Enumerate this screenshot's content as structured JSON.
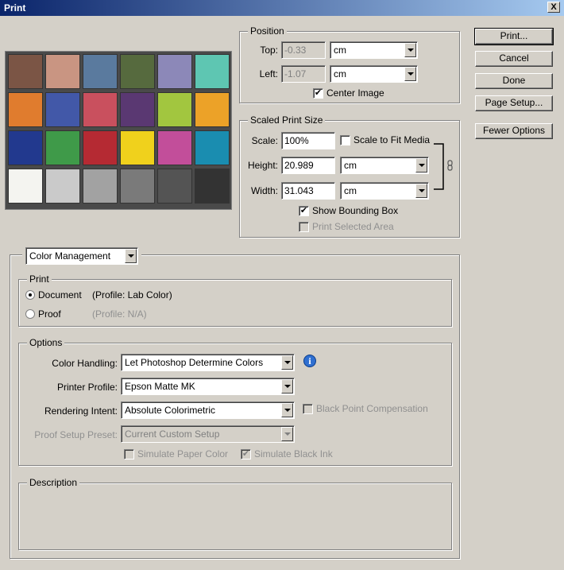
{
  "window": {
    "title": "Print",
    "close_glyph": "X"
  },
  "buttons": {
    "print": "Print...",
    "cancel": "Cancel",
    "done": "Done",
    "page_setup": "Page Setup...",
    "fewer_options": "Fewer Options"
  },
  "preview": {
    "swatches": [
      "#7b5545",
      "#c99582",
      "#5a7a9e",
      "#566a3e",
      "#8c88b8",
      "#5ec6b2",
      "#e07c2e",
      "#4258a8",
      "#c9505e",
      "#5a3872",
      "#a2c63f",
      "#eca228",
      "#22398e",
      "#3f9a49",
      "#b52a33",
      "#f0d11c",
      "#c24e9a",
      "#1a8db0",
      "#f4f4f0",
      "#cacaca",
      "#a2a2a2",
      "#7a7a7a",
      "#545454",
      "#333333"
    ]
  },
  "position": {
    "legend": "Position",
    "top_label": "Top:",
    "top_value": "-0.33",
    "top_unit": "cm",
    "left_label": "Left:",
    "left_value": "-1.07",
    "left_unit": "cm",
    "center_label": "Center Image",
    "center_checked": "✔"
  },
  "scaled": {
    "legend": "Scaled Print Size",
    "scale_label": "Scale:",
    "scale_value": "100%",
    "fit_label": "Scale to Fit Media",
    "height_label": "Height:",
    "height_value": "20.989",
    "height_unit": "cm",
    "width_label": "Width:",
    "width_value": "31.043",
    "width_unit": "cm",
    "bbox_label": "Show Bounding Box",
    "bbox_checked": "✔",
    "selected_label": "Print Selected Area"
  },
  "color_mgmt": {
    "dropdown": "Color Management"
  },
  "print_group": {
    "legend": "Print",
    "document_label": "Document",
    "document_profile": "(Profile: Lab Color)",
    "proof_label": "Proof",
    "proof_profile": "(Profile: N/A)"
  },
  "options": {
    "legend": "Options",
    "color_handling_label": "Color Handling:",
    "color_handling_value": "Let Photoshop Determine Colors",
    "printer_profile_label": "Printer Profile:",
    "printer_profile_value": "Epson Matte MK",
    "rendering_intent_label": "Rendering Intent:",
    "rendering_intent_value": "Absolute Colorimetric",
    "bpc_label": "Black Point Compensation",
    "proof_preset_label": "Proof Setup Preset:",
    "proof_preset_value": "Current Custom Setup",
    "paper_color_label": "Simulate Paper Color",
    "black_ink_label": "Simulate Black Ink",
    "black_ink_checked": "✔",
    "info_glyph": "i"
  },
  "description": {
    "legend": "Description"
  }
}
